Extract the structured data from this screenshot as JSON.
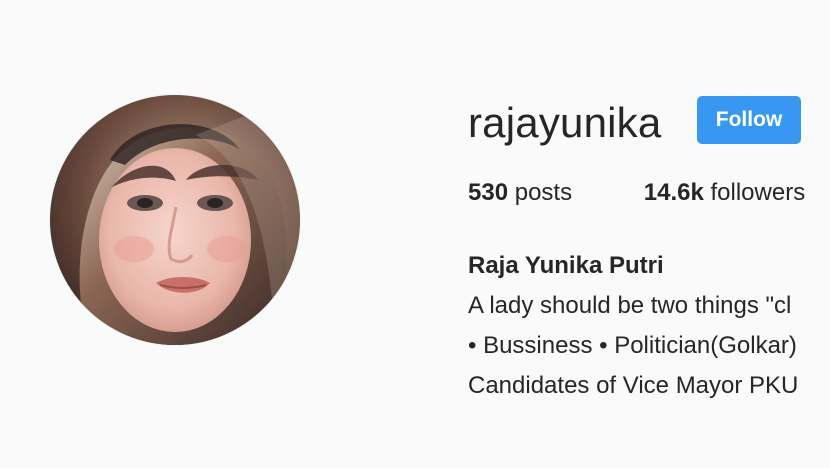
{
  "profile": {
    "username": "rajayunika",
    "follow_label": "Follow",
    "stats": {
      "posts_count": "530",
      "posts_label": "posts",
      "followers_count": "14.6k",
      "followers_label": "followers"
    },
    "bio": {
      "full_name": "Raja Yunika Putri",
      "lines": [
        "A lady should be two things \"cl",
        "• Bussiness • Politician(Golkar)",
        "Candidates of Vice Mayor PKU"
      ]
    }
  },
  "colors": {
    "background": "#fafafa",
    "primary_text": "#262626",
    "follow_button": "#3897f0",
    "follow_text": "#ffffff"
  },
  "icons": {
    "avatar": "profile-photo"
  }
}
